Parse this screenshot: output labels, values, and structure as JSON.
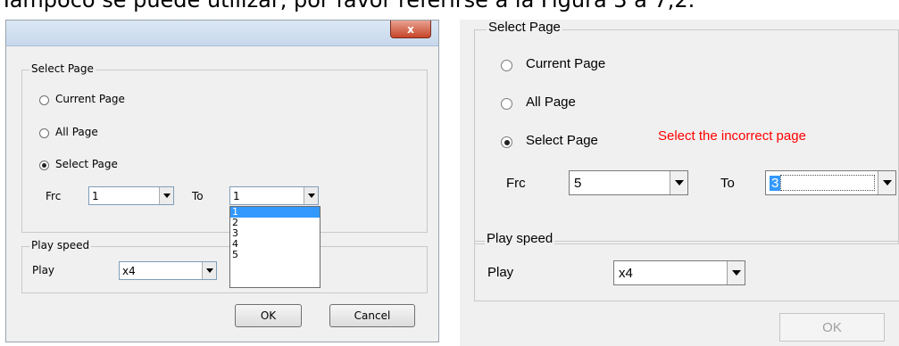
{
  "top_text": "Tampoco se puede utilizar, por favor referirse a la Figura 3 a 7,2.",
  "left_dialog": {
    "close_glyph": "x",
    "select_page_group": "Select Page",
    "radio_current": "Current Page",
    "radio_all": "All Page",
    "radio_select": "Select Page",
    "from_label": "Frc",
    "from_value": "1",
    "to_label": "To",
    "to_value": "1",
    "dropdown_options": [
      "1",
      "2",
      "3",
      "4",
      "5"
    ],
    "play_speed_group": "Play speed",
    "play_label": "Play",
    "play_value": "x4",
    "ok_label": "OK",
    "cancel_label": "Cancel"
  },
  "right_dialog": {
    "select_page_group": "Select Page",
    "radio_current": "Current Page",
    "radio_all": "All Page",
    "radio_select": "Select Page",
    "error_text": "Select the incorrect page",
    "error_color": "#ff0000",
    "from_label": "Frc",
    "from_value": "5",
    "to_label": "To",
    "to_value": "3",
    "play_speed_group": "Play speed",
    "play_label": "Play",
    "play_value": "x4",
    "ok_label": "OK"
  },
  "icons": [
    "close-icon",
    "dropdown-arrow-icon",
    "radio-dot-icon"
  ]
}
